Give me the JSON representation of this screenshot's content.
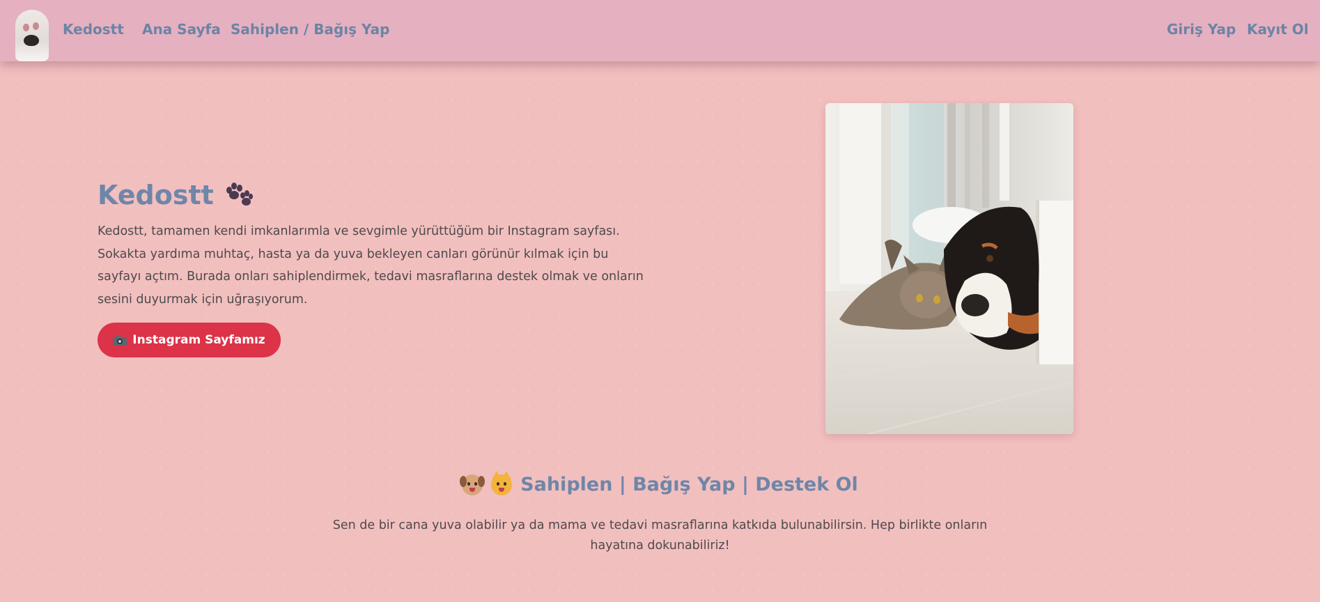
{
  "navbar": {
    "brand": "Kedostt",
    "links": [
      "Ana Sayfa",
      "Sahiplen / Bağış Yap"
    ],
    "auth": [
      "Giriş Yap",
      "Kayıt Ol"
    ]
  },
  "hero": {
    "title": "Kedostt",
    "title_icon": "paw-prints-icon",
    "description": "Kedostt, tamamen kendi imkanlarımla ve sevgimle yürüttüğüm bir Instagram sayfası. Sokakta yardıma muhtaç, hasta ya da yuva bekleyen canları görünür kılmak için bu sayfayı açtım. Burada onları sahiplendirmek, tedavi masraflarına destek olmak ve onların sesini duyurmak için uğraşıyorum.",
    "button_label": "Instagram Sayfamız",
    "button_icon": "camera-icon",
    "image_icon": "cat-and-dog-photo"
  },
  "section": {
    "title": "Sahiplen | Bağış Yap | Destek Ol",
    "title_icons": [
      "dog-face-icon",
      "cat-face-icon"
    ],
    "text": "Sen de bir cana yuva olabilir ya da mama ve tedavi masraflarına katkıda bulunabilirsin. Hep birlikte onların hayatına dokunabiliriz!"
  },
  "colors": {
    "navbar_bg": "#e5b0c0",
    "page_bg": "#f2bfbf",
    "accent_text": "#6e86a8",
    "button_bg": "#dc3348"
  }
}
